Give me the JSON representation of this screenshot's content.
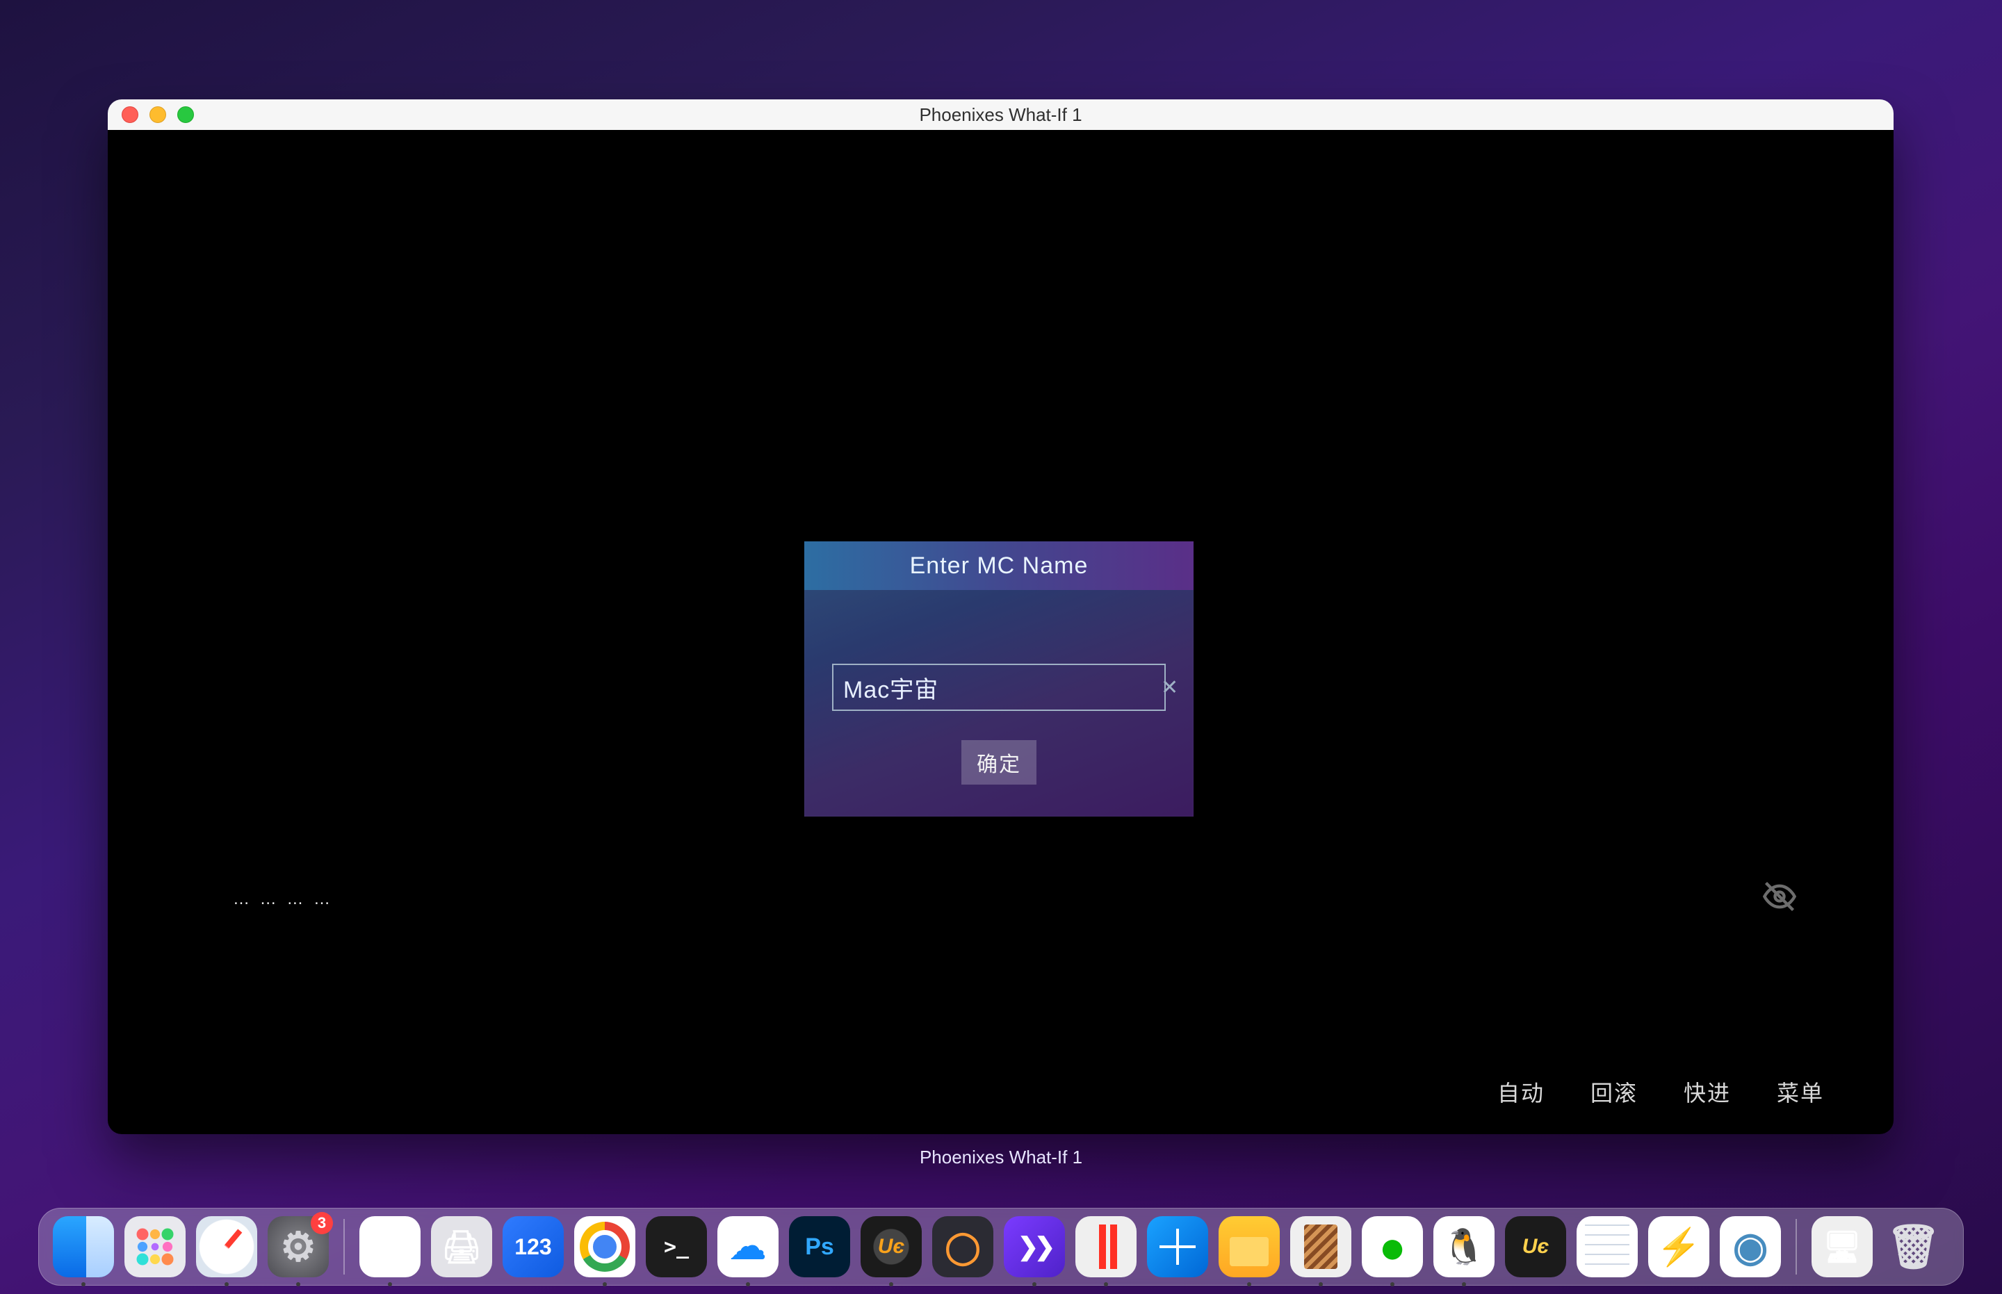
{
  "window": {
    "title": "Phoenixes What-If 1"
  },
  "caption": "Phoenixes What-If 1",
  "dialog": {
    "title": "Enter MC Name",
    "input_value": "Mac宇宙",
    "clear_glyph": "✕",
    "confirm_label": "确定"
  },
  "dots_text": "… … … …",
  "vn_nav": {
    "auto": "自动",
    "rollback": "回滚",
    "skip": "快进",
    "menu": "菜单"
  },
  "dock": {
    "badge_settings": "3",
    "label_123": "123",
    "label_ps": "Ps",
    "label_ue": "Uє",
    "label_ue2": "Uє"
  }
}
